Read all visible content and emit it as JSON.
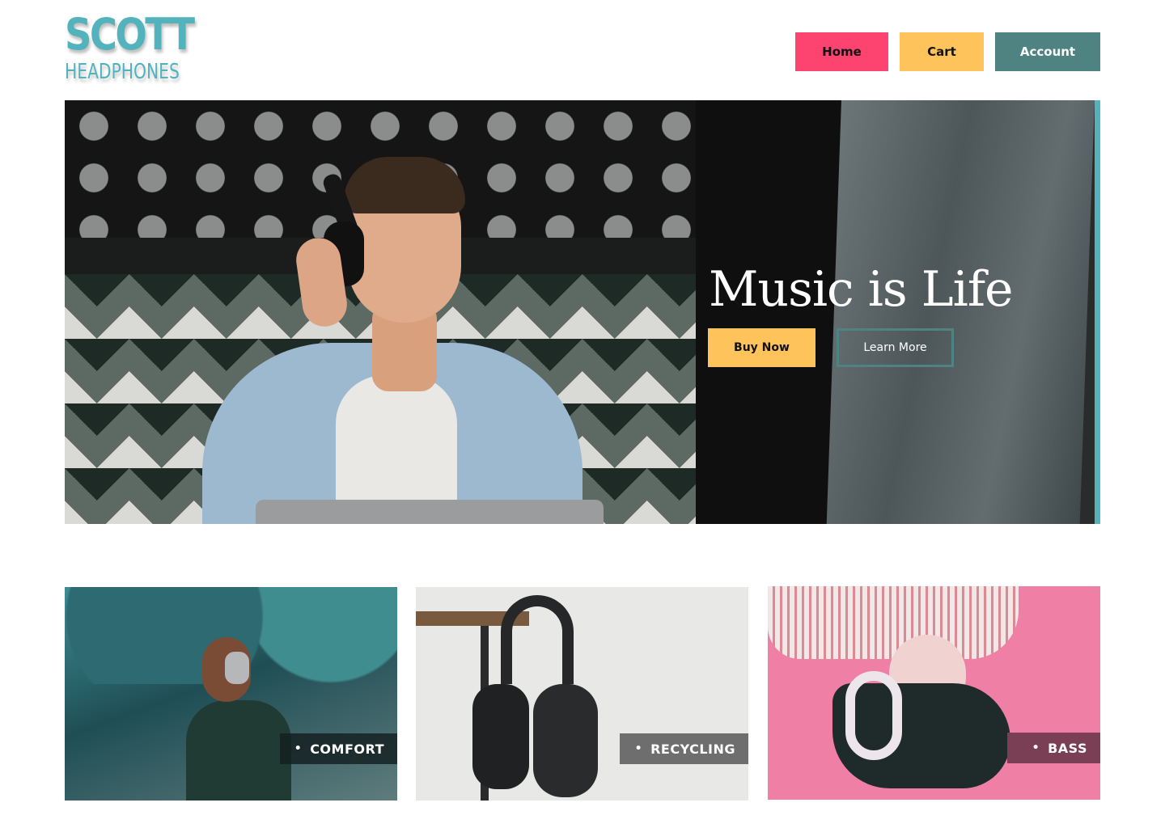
{
  "brand": {
    "name_line1": "SCOTT",
    "name_line2": "HEADPHONES",
    "color": "#52b3bd"
  },
  "nav": {
    "home": "Home",
    "cart": "Cart",
    "account": "Account",
    "colors": {
      "home": "#fd4470",
      "cart": "#ffc35b",
      "account": "#4e8381"
    }
  },
  "hero": {
    "title": "Music is Life",
    "buy_label": "Buy Now",
    "learn_label": "Learn More",
    "accent": "#52b3bd"
  },
  "features": [
    {
      "label": "COMFORT",
      "bullet": "•"
    },
    {
      "label": "RECYCLING",
      "bullet": "•"
    },
    {
      "label": "BASS",
      "bullet": "•"
    }
  ]
}
